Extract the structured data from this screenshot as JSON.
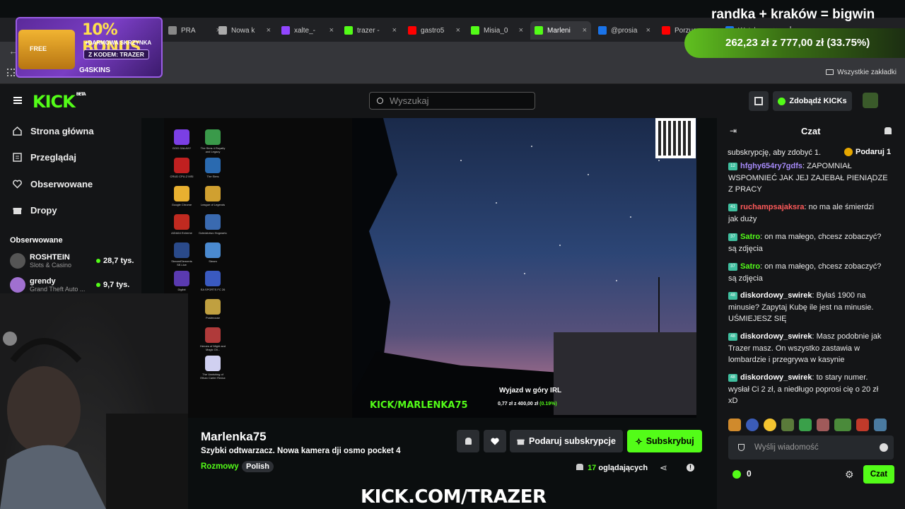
{
  "stream_overlay": {
    "top_title": "randka + kraków = bigwin",
    "goal_text": "262,23 zł z 777,00 zł (33.75%)",
    "bottom_url": "KICK.COM/TRAZER",
    "promo": {
      "headline": "10% BONUS",
      "sub1": "+DARMOWA SKRZYNKA",
      "code": "Z KODEM: TRAZER",
      "brand": "G4SKINS",
      "free": "FREE"
    }
  },
  "browser": {
    "tabs": [
      {
        "label": "PRA",
        "color": "#888888"
      },
      {
        "label": "Nowa k",
        "color": "#aaaaaa"
      },
      {
        "label": "xalte_-",
        "color": "#9146ff"
      },
      {
        "label": "trazer -",
        "color": "#53fc18"
      },
      {
        "label": "gastro5",
        "color": "#ff0000"
      },
      {
        "label": "Misia_0",
        "color": "#53fc18"
      },
      {
        "label": "Marleni",
        "color": "#53fc18"
      },
      {
        "label": "@prosia",
        "color": "#1a73e8"
      },
      {
        "label": "Porzuc",
        "color": "#ff0000"
      },
      {
        "label": "Watch",
        "color": "#1a73e8"
      }
    ],
    "all_bookmarks": "Wszystkie zakładki"
  },
  "header": {
    "logo": "KICK",
    "beta": "BETA",
    "search_placeholder": "Wyszukaj",
    "get_kicks": "Zdobądź KICKs"
  },
  "sidebar": {
    "nav": [
      {
        "label": "Strona główna",
        "icon": "home-icon"
      },
      {
        "label": "Przeglądaj",
        "icon": "browse-icon"
      },
      {
        "label": "Obserwowane",
        "icon": "heart-icon"
      },
      {
        "label": "Dropy",
        "icon": "gift-icon"
      }
    ],
    "following_title": "Obserwowane",
    "following": [
      {
        "name": "ROSHTEIN",
        "game": "Slots & Casino",
        "viewers": "28,7 tys."
      },
      {
        "name": "grendy",
        "game": "Grand Theft Auto ...",
        "viewers": "9,7 tys."
      }
    ]
  },
  "video": {
    "watermark": "KICK/MARLENKA75",
    "goal_title": "Wyjazd w góry IRL",
    "goal_amount": "0,77 zł z 400,00 zł",
    "goal_percent": "(0.19%)",
    "desktop_icons": [
      "GOG GALAXY",
      "The Sims 4 Royalty and Legacy",
      "CRUD CPU-Z MSI",
      "The Sims",
      "Google Chrome",
      "League of Legends",
      "AIDA64 Extreme",
      "Dziedzictwo Hogwartu",
      "StreamElements SE.Live",
      "Steam",
      "Digibit",
      "EA SPORTS FC 26",
      "",
      "Postmouse",
      "",
      "Heroes of Might and Magic Oli...",
      "",
      "The Vanishing of Ethan Carter Redux"
    ]
  },
  "channel": {
    "name": "Marlenka75",
    "title": "Szybki odtwarzacz. Nowa kamera dji osmo pocket 4",
    "category": "Rozmowy",
    "tag": "Polish",
    "gift_sub": "Podaruj subskrypcje",
    "subscribe": "Subskrybuj",
    "viewers_count": "17",
    "viewers_label": "oglądających"
  },
  "chat": {
    "title": "Czat",
    "pinned": "subskrypcję, aby zdobyć 1.",
    "pinned_btn": "Podaruj 1",
    "messages": [
      {
        "badge": "12",
        "user": "hfghy654ry7gdfs",
        "color": "#a78bfa",
        "lines": [
          "ZAPOMNIAŁ",
          "WSPOMNIEĆ JAK JEJ ZAJEBAŁ PIENIĄDZE",
          "Z PRACY"
        ]
      },
      {
        "badge": "41",
        "user": "ruchampsajaksra",
        "color": "#ff5a5a",
        "lines": [
          "no ma ale śmierdzi",
          "jak duży"
        ]
      },
      {
        "badge": "37",
        "user": "Satro",
        "color": "#53fc18",
        "lines": [
          "on ma małego, chcesz zobaczyć?",
          "są zdjęcia"
        ]
      },
      {
        "badge": "37",
        "user": "Satro",
        "color": "#53fc18",
        "lines": [
          "on ma małego, chcesz zobaczyć?",
          "są zdjęcia"
        ]
      },
      {
        "badge": "48",
        "user": "diskordowy_swirek",
        "color": "#ffffff",
        "lines": [
          "Byłaś 1900 na",
          "minusie? Zapytaj Kubę ile jest na minusie.",
          "UŚMIEJESZ SIĘ"
        ]
      },
      {
        "badge": "48",
        "user": "diskordowy_swirek",
        "color": "#ffffff",
        "lines": [
          "Masz podobnie jak",
          "Trazer masz. On wszystko zastawia w",
          "lombardzie i przegrywa w kasynie"
        ]
      },
      {
        "badge": "48",
        "user": "diskordowy_swirek",
        "color": "#ffffff",
        "lines": [
          "to stary numer.",
          "wysłał Ci 2 zł, a niedługo poprosi cię o 20 zł",
          "xD"
        ]
      }
    ],
    "input_placeholder": "Wyślij wiadomość",
    "points": "0",
    "send": "Czat"
  }
}
